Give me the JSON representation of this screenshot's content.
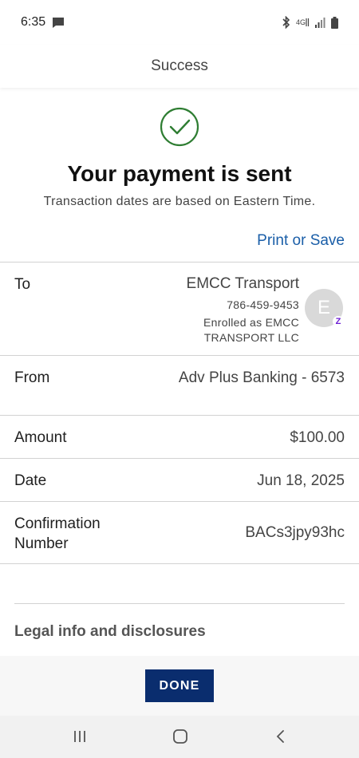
{
  "status_bar": {
    "time": "6:35",
    "icons": [
      "message-icon",
      "bluetooth-icon",
      "lte-icon",
      "signal-icon",
      "battery-icon"
    ]
  },
  "app_bar": {
    "title": "Success"
  },
  "hero": {
    "icon": "check-circle-icon",
    "headline": "Your payment is sent",
    "subtext": "Transaction dates are based on Eastern Time."
  },
  "actions": {
    "print_or_save": "Print or Save"
  },
  "details": {
    "to": {
      "label": "To",
      "name": "EMCC Transport",
      "phone": "786-459-9453",
      "enrolled_line1": "Enrolled as EMCC",
      "enrolled_line2": "TRANSPORT LLC",
      "avatar_initial": "E",
      "badge_letter": "Z"
    },
    "from": {
      "label": "From",
      "value": "Adv Plus Banking - 6573"
    },
    "amount": {
      "label": "Amount",
      "value": "$100.00"
    },
    "date": {
      "label": "Date",
      "value": "Jun 18, 2025"
    },
    "confirmation": {
      "label_line1": "Confirmation",
      "label_line2": "Number",
      "value": "BACs3jpy93hc"
    }
  },
  "legal": {
    "label": "Legal info and disclosures"
  },
  "footer": {
    "done_label": "DONE"
  },
  "nav_bar": {
    "icons": [
      "recent-apps-icon",
      "home-icon",
      "back-icon"
    ]
  },
  "colors": {
    "link": "#1a5ea8",
    "success": "#2e7d32",
    "primary_button": "#0a2d6e",
    "zelle": "#6d1ed4"
  }
}
